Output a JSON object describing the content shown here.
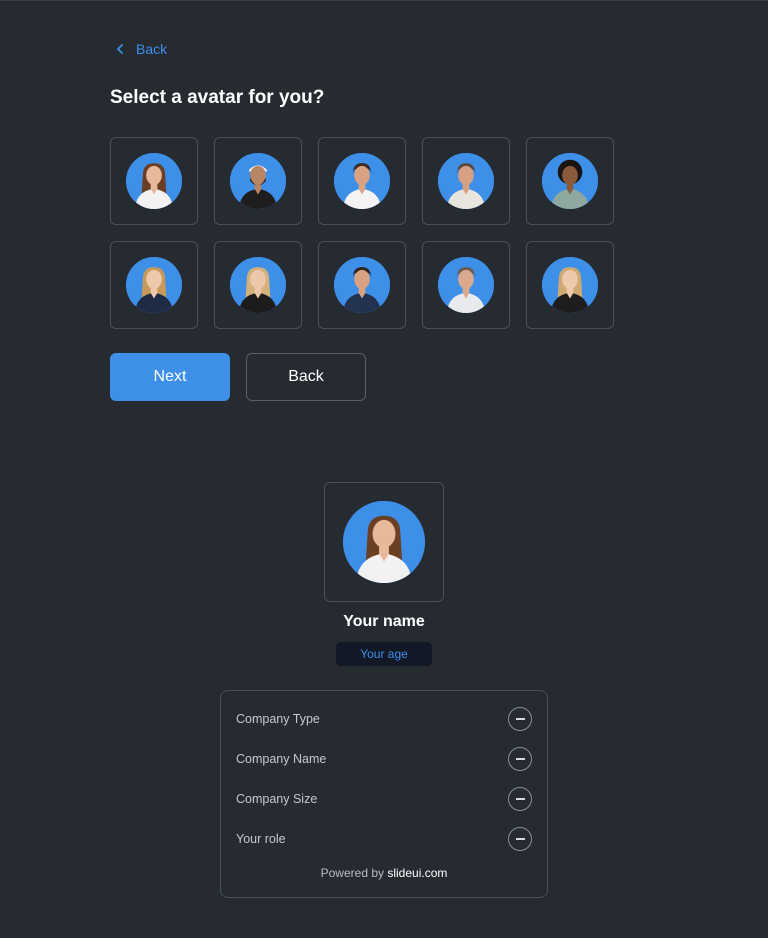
{
  "header": {
    "back_label": "Back",
    "title": "Select a avatar for you?"
  },
  "avatars": [
    {
      "name": "avatar-woman-glasses",
      "skin": "#e7b99a",
      "hair": "#6b3f24",
      "shirt": "#f2f2f2",
      "hair_style": "long"
    },
    {
      "name": "avatar-man-beard-cap",
      "skin": "#b98663",
      "hair": "#2b2220",
      "shirt": "#1e1e1e",
      "hair_style": "cap"
    },
    {
      "name": "avatar-man-white-shirt",
      "skin": "#d9a383",
      "hair": "#3a2a22",
      "shirt": "#f4f4f4",
      "hair_style": "short"
    },
    {
      "name": "avatar-man-arms-crossed",
      "skin": "#d6a083",
      "hair": "#5a4a3e",
      "shirt": "#e8e6dc",
      "hair_style": "short"
    },
    {
      "name": "avatar-woman-curly",
      "skin": "#8a5a3c",
      "hair": "#1a1412",
      "shirt": "#8fa8a0",
      "hair_style": "curly"
    },
    {
      "name": "avatar-woman-blonde-suit",
      "skin": "#edc8aa",
      "hair": "#c89a5a",
      "shirt": "#1f2a44",
      "hair_style": "long"
    },
    {
      "name": "avatar-woman-blonde-black",
      "skin": "#ecc7a9",
      "hair": "#d4b07a",
      "shirt": "#1c1c1c",
      "hair_style": "long"
    },
    {
      "name": "avatar-man-navy-suit",
      "skin": "#d9a383",
      "hair": "#2e2520",
      "shirt": "#233250",
      "hair_style": "short"
    },
    {
      "name": "avatar-man-tie",
      "skin": "#d8a98c",
      "hair": "#6b5a4e",
      "shirt": "#e9eaee",
      "hair_style": "short"
    },
    {
      "name": "avatar-woman-blonde-2",
      "skin": "#eec9ab",
      "hair": "#cfa970",
      "shirt": "#1d1d1d",
      "hair_style": "long"
    }
  ],
  "actions": {
    "next_label": "Next",
    "back_label": "Back"
  },
  "profile": {
    "name": "Your name",
    "age_placeholder": "Your age",
    "fields": [
      "Company Type",
      "Company Name",
      "Company Size",
      "Your role"
    ],
    "powered_prefix": "Powered by",
    "powered_brand": "slideui.com"
  },
  "colors": {
    "background": "#262b32",
    "accent": "#3d8fe8",
    "border": "#4a5059"
  }
}
